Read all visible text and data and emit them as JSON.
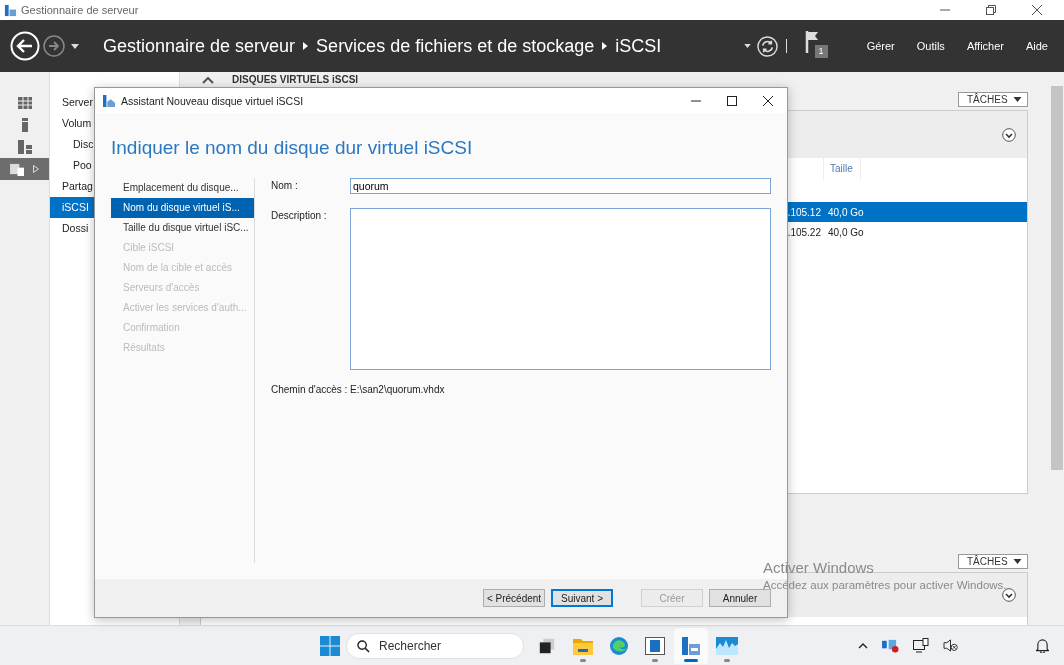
{
  "window": {
    "title": "Gestionnaire de serveur"
  },
  "header": {
    "breadcrumb": [
      "Gestionnaire de serveur",
      "Services de fichiers et de stockage",
      "iSCSI"
    ],
    "notification_count": "1",
    "menu": [
      "Gérer",
      "Outils",
      "Afficher",
      "Aide"
    ]
  },
  "rail": [
    {
      "kind": "dashboard",
      "selected": false
    },
    {
      "kind": "server",
      "selected": false
    },
    {
      "kind": "roles",
      "selected": false
    },
    {
      "kind": "storage",
      "selected": true
    }
  ],
  "nav": [
    {
      "label": "Server",
      "selected": false
    },
    {
      "label": "Volum",
      "selected": false,
      "children": [
        {
          "label": "Disc",
          "selected": false
        },
        {
          "label": "Poo",
          "selected": false
        }
      ]
    },
    {
      "label": "Partag",
      "selected": false
    },
    {
      "label": "iSCSI",
      "selected": true
    },
    {
      "label": "Dossi",
      "selected": false
    }
  ],
  "section": {
    "title": "DISQUES VIRTUELS iSCSI",
    "tasks": "TÂCHES",
    "columns": [
      "",
      "Taille"
    ],
    "rows": [
      {
        "cells": [
          ".105.12",
          "40,0 Go"
        ],
        "selected": true
      },
      {
        "cells": [
          ".105.22",
          "40,0 Go"
        ],
        "selected": false
      }
    ]
  },
  "section2": {
    "tasks": "TÂCHES"
  },
  "dialog": {
    "title": "Assistant Nouveau disque virtuel iSCSI",
    "heading": "Indiquer le nom du disque dur virtuel iSCSI",
    "steps": [
      {
        "label": "Emplacement du disque...",
        "selected": false,
        "disabled": false
      },
      {
        "label": "Nom du disque virtuel iS...",
        "selected": true,
        "disabled": false
      },
      {
        "label": "Taille du disque virtuel iSC...",
        "selected": false,
        "disabled": false
      },
      {
        "label": "Cible iSCSI",
        "selected": false,
        "disabled": true
      },
      {
        "label": "Nom de la cible et accès",
        "selected": false,
        "disabled": true
      },
      {
        "label": "Serveurs d'accès",
        "selected": false,
        "disabled": true
      },
      {
        "label": "Activer les services d'auth...",
        "selected": false,
        "disabled": true
      },
      {
        "label": "Confirmation",
        "selected": false,
        "disabled": true
      },
      {
        "label": "Résultats",
        "selected": false,
        "disabled": true
      }
    ],
    "name_label": "Nom :",
    "name_value": "quorum",
    "description_label": "Description :",
    "path_label": "Chemin d'accès :",
    "path_value": "E:\\san2\\quorum.vhdx",
    "buttons": [
      {
        "label": "< Précédent",
        "disabled": false,
        "default": false
      },
      {
        "label": "Suivant >",
        "disabled": false,
        "default": true
      },
      {
        "label": "Créer",
        "disabled": true,
        "default": false
      },
      {
        "label": "Annuler",
        "disabled": false,
        "default": false
      }
    ]
  },
  "activation": {
    "title": "Activer Windows",
    "text": "Accédez aux paramètres pour activer Windows."
  },
  "taskbar": {
    "search_placeholder": "Rechercher",
    "apps": [
      {
        "kind": "taskview",
        "running": false,
        "active": false
      },
      {
        "kind": "folder",
        "running": true,
        "active": false
      },
      {
        "kind": "browser",
        "running": false,
        "active": false
      },
      {
        "kind": "window",
        "running": true,
        "active": false
      },
      {
        "kind": "server",
        "running": true,
        "active": true
      },
      {
        "kind": "monitor",
        "running": true,
        "active": false
      }
    ]
  }
}
